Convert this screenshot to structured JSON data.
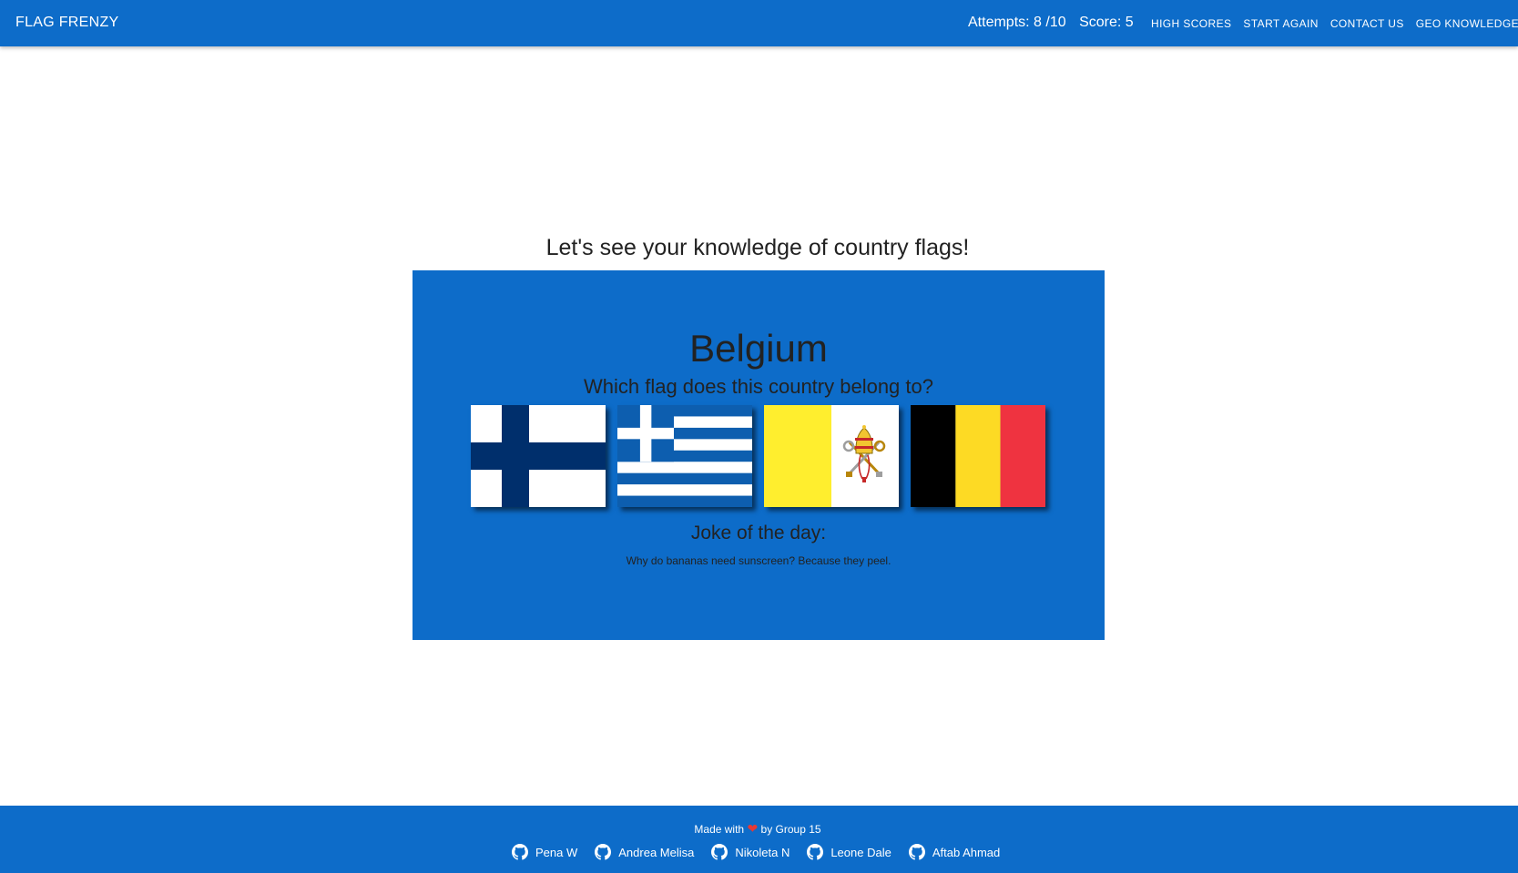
{
  "nav": {
    "brand": "FLAG FRENZY",
    "attempts": "Attempts: 8 /10",
    "score": "Score: 5",
    "links": [
      "HIGH SCORES",
      "START AGAIN",
      "CONTACT US",
      "GEO KNOWLEDGE"
    ]
  },
  "main": {
    "intro": "Let's see your knowledge of country flags!",
    "country": "Belgium",
    "question": "Which flag does this country belong to?",
    "flags": [
      {
        "icon": "finland-flag-icon"
      },
      {
        "icon": "greece-flag-icon"
      },
      {
        "icon": "vatican-flag-icon"
      },
      {
        "icon": "belgium-flag-icon"
      }
    ],
    "joke_title": "Joke of the day:",
    "joke_text": "Why do bananas need sunscreen? Because they peel."
  },
  "footer": {
    "made_prefix": "Made with",
    "made_suffix": "by Group 15",
    "heart_icon": "heart-icon",
    "authors": [
      "Pena W",
      "Andrea Melisa",
      "Nikoleta N",
      "Leone Dale",
      "Aftab Ahmad"
    ]
  },
  "colors": {
    "primary": "#0d6cc9",
    "text_dark": "#222222",
    "heart": "#e53935"
  }
}
